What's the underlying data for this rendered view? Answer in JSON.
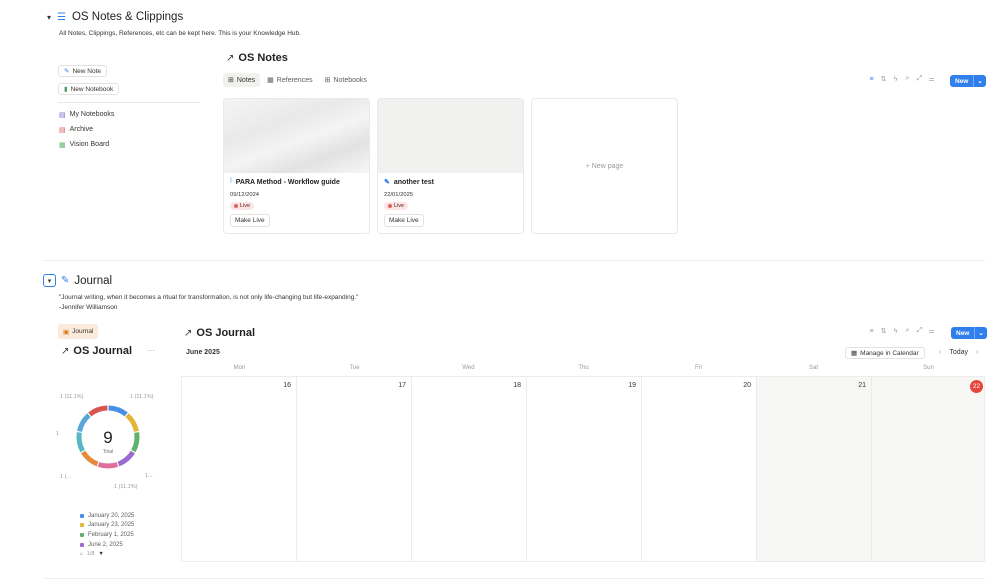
{
  "notes_section": {
    "toggle": "▾",
    "title": "OS Notes & Clippings",
    "description": "All Notes, Clippings, References, etc can be kept here. This is your Knowledge Hub.",
    "side_buttons": [
      "New Note",
      "New Notebook"
    ],
    "side_links": [
      "My Notebooks",
      "Archive",
      "Vision Board"
    ],
    "db_title": "OS Notes",
    "tabs": [
      "Notes",
      "References",
      "Notebooks"
    ],
    "new_label": "New",
    "cards": [
      {
        "title": "PARA Method - Workflow guide",
        "date": "09/12/2024",
        "status": "Live",
        "action": "Make Live"
      },
      {
        "title": "another test",
        "date": "22/01/2025",
        "status": "Live",
        "action": "Make Live"
      }
    ],
    "new_page": "+ New page"
  },
  "journal_section": {
    "toggle": "▾",
    "title": "Journal",
    "quote_line1": "\"Journal writing, when it becomes a ritual for transformation, is not only life-changing but life-expanding.\"",
    "quote_line2": "-Jennifer Williamson",
    "journal_button": "Journal",
    "side_db_title": "OS Journal",
    "side_more": "···",
    "db_title": "OS Journal",
    "new_label": "New",
    "month": "June 2025",
    "manage_calendar": "Manage in Calendar",
    "today": "Today",
    "weekdays": [
      "Mon",
      "Tue",
      "Wed",
      "Thu",
      "Fri",
      "Sat",
      "Sun"
    ],
    "days": [
      "16",
      "17",
      "18",
      "19",
      "20",
      "21",
      "22"
    ],
    "today_day": "22"
  },
  "chart_data": {
    "type": "pie",
    "center_value": "9",
    "center_label": "Total",
    "slice_labels": [
      "1 (11.1%)",
      "1 (11.1%)",
      "1",
      "1 (11.1%)",
      "1 (...",
      "1..."
    ],
    "legend": [
      {
        "label": "January 20, 2025",
        "color": "#4a8fe7"
      },
      {
        "label": "January 23, 2025",
        "color": "#e5b53a"
      },
      {
        "label": "February 1, 2025",
        "color": "#5fb26b"
      },
      {
        "label": "June 2, 2025",
        "color": "#9b6bd1"
      }
    ],
    "pager": "1/8",
    "series": [
      {
        "name": "January 20, 2025",
        "value": 1,
        "color": "#4a8fe7"
      },
      {
        "name": "January 23, 2025",
        "value": 1,
        "color": "#e5b53a"
      },
      {
        "name": "February 1, 2025",
        "value": 1,
        "color": "#5fb26b"
      },
      {
        "name": "June 2, 2025",
        "value": 1,
        "color": "#9b6bd1"
      },
      {
        "value": 1,
        "color": "#e06e9c"
      },
      {
        "value": 1,
        "color": "#e58a3c"
      },
      {
        "value": 1,
        "color": "#56b7c4"
      },
      {
        "value": 1,
        "color": "#57a8d9"
      },
      {
        "value": 1,
        "color": "#d9534f"
      }
    ]
  }
}
